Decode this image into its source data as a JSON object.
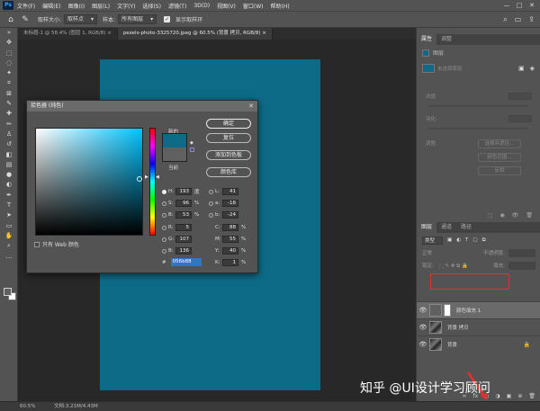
{
  "menubar": {
    "logo": "Ps",
    "items": [
      "文件(F)",
      "编辑(E)",
      "图像(I)",
      "图层(L)",
      "文字(Y)",
      "选择(S)",
      "滤镜(T)",
      "3D(D)",
      "视图(V)",
      "窗口(W)",
      "帮助(H)"
    ],
    "window_controls": [
      "—",
      "□",
      "✕"
    ]
  },
  "optbar": {
    "sample_size_label": "取样大小:",
    "sample_size_value": "取样点",
    "sample_label": "样本:",
    "sample_value": "所有图层",
    "show_ring_label": "显示取样环",
    "checkbox_mark": "✓"
  },
  "tabs": [
    {
      "label": "未标题-1 @ 58.4% (图层 1, RGB/8) ×",
      "active": false
    },
    {
      "label": "pexels-photo-3325720.jpeg @ 60.5% (背景 拷贝, RGB/8) ×",
      "active": true
    }
  ],
  "statusbar": {
    "zoom": "60.5%",
    "doc_info": "文档:3.21M/4.43M"
  },
  "colors": {
    "doc_fill": "#0e6b88",
    "current_color": "#606060",
    "highlight": "#e03030"
  },
  "picker": {
    "title": "拾色器 (纯色)",
    "close": "✕",
    "new_label": "新的",
    "current_label": "当前",
    "web_only_label": "只有 Web 颜色",
    "buttons": {
      "ok": "确定",
      "reset": "复位",
      "add_to_swatches": "添加到色板",
      "color_libraries": "颜色库"
    },
    "fields": {
      "H": {
        "label": "H:",
        "value": "193",
        "unit": "度"
      },
      "S": {
        "label": "S:",
        "value": "96",
        "unit": "%"
      },
      "B": {
        "label": "B:",
        "value": "53",
        "unit": "%"
      },
      "R": {
        "label": "R:",
        "value": "5",
        "unit": ""
      },
      "G": {
        "label": "G:",
        "value": "107",
        "unit": ""
      },
      "Bl": {
        "label": "B:",
        "value": "136",
        "unit": ""
      },
      "L": {
        "label": "L:",
        "value": "41",
        "unit": ""
      },
      "a": {
        "label": "a:",
        "value": "-18",
        "unit": ""
      },
      "b": {
        "label": "b:",
        "value": "-24",
        "unit": ""
      },
      "C": {
        "label": "C:",
        "value": "88",
        "unit": "%"
      },
      "M": {
        "label": "M:",
        "value": "55",
        "unit": "%"
      },
      "Y": {
        "label": "Y:",
        "value": "40",
        "unit": "%"
      },
      "K": {
        "label": "K:",
        "value": "1",
        "unit": "%"
      }
    },
    "hex_label": "#",
    "hex_value": "056b88"
  },
  "properties": {
    "tabs": [
      "属性",
      "调整"
    ],
    "head": "图层",
    "mask_label": "未选择蒙版",
    "density_label": "浓度:",
    "feather_label": "羽化:",
    "refine_label": "调整:",
    "btn_select_mask": "选择并遮住...",
    "btn_color_range": "颜色范围...",
    "btn_invert": "反相",
    "bottom_icons": [
      "⬚",
      "◉",
      "👁",
      "🗑"
    ]
  },
  "layers": {
    "tabs": [
      "图层",
      "通道",
      "路径"
    ],
    "kind_label": "类型",
    "mode_label": "正常",
    "opacity_label": "不透明度:",
    "lock_label": "锁定:",
    "fill_label": "填充:",
    "items": [
      {
        "name": "颜色填充 1",
        "selected": true
      },
      {
        "name": "背景 拷贝",
        "selected": false
      },
      {
        "name": "背景",
        "selected": false,
        "locked": true
      }
    ],
    "bottom_icons": [
      "∞",
      "fx",
      "◐",
      "◑",
      "▣",
      "⊕",
      "🗑"
    ]
  },
  "watermark": "知乎 @UI设计学习顾问"
}
